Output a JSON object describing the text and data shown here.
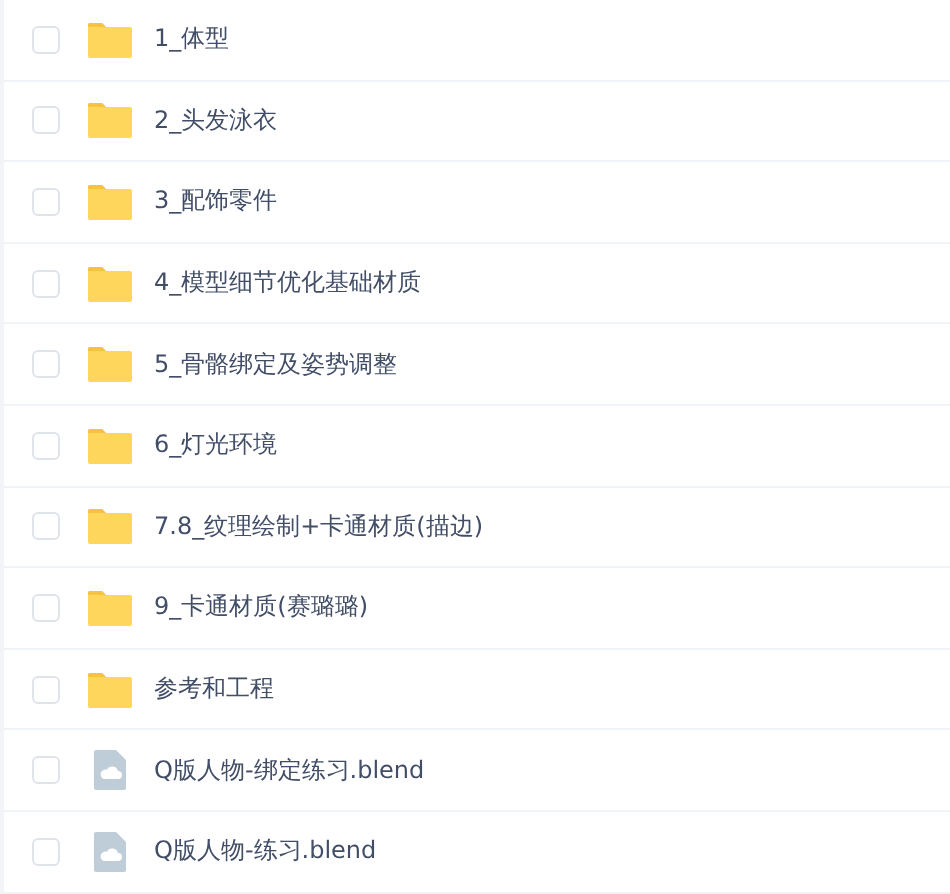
{
  "files": [
    {
      "kind": "folder",
      "name": "1_体型",
      "checked": false
    },
    {
      "kind": "folder",
      "name": "2_头发泳衣",
      "checked": false
    },
    {
      "kind": "folder",
      "name": "3_配饰零件",
      "checked": false
    },
    {
      "kind": "folder",
      "name": "4_模型细节优化基础材质",
      "checked": false
    },
    {
      "kind": "folder",
      "name": "5_骨骼绑定及姿势调整",
      "checked": false
    },
    {
      "kind": "folder",
      "name": "6_灯光环境",
      "checked": false
    },
    {
      "kind": "folder",
      "name": "7.8_纹理绘制+卡通材质(描边)",
      "checked": false
    },
    {
      "kind": "folder",
      "name": "9_卡通材质(赛璐璐)",
      "checked": false
    },
    {
      "kind": "folder",
      "name": "参考和工程",
      "checked": false
    },
    {
      "kind": "file",
      "name": "Q版人物-绑定练习.blend",
      "checked": false
    },
    {
      "kind": "file",
      "name": "Q版人物-练习.blend",
      "checked": false
    }
  ]
}
